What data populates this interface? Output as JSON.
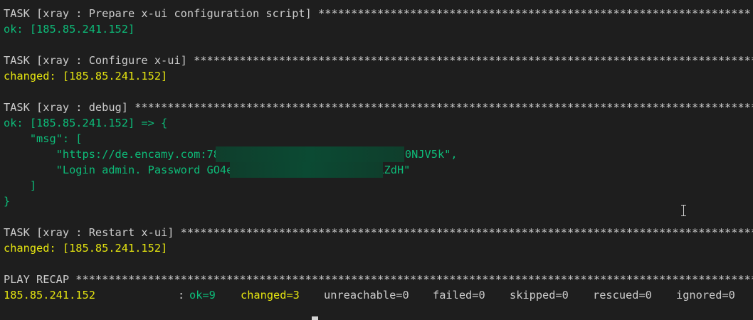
{
  "tasks": [
    {
      "header": "TASK [xray : Prepare x-ui configuration script] ******************************************************************",
      "status": "ok: [185.85.241.152]"
    },
    {
      "header": "TASK [xray : Configure x-ui] ****************************************************************************************",
      "status": "changed: [185.85.241.152]"
    },
    {
      "header": "TASK [xray : debug] *************************************************************************************************",
      "status": "ok: [185.85.241.152] => {"
    },
    {
      "header": "TASK [xray : Restart x-ui] ******************************************************************************************",
      "status": "changed: [185.85.241.152]"
    }
  ],
  "debug_output": {
    "msg_open": "    \"msg\": [",
    "url_line_prefix": "        \"https://de.encamy.com:78",
    "url_line_suffix": "0NJV5k\",",
    "login_line_prefix": "        \"Login admin. Password GO4e",
    "login_line_suffix": "LZdH\"",
    "msg_close": "    ]",
    "brace_close": "}"
  },
  "recap": {
    "header": "PLAY RECAP **********************************************************************************************************",
    "host": "185.85.241.152",
    "colon": ":",
    "ok": "ok=9",
    "changed": "changed=3",
    "unreachable": "unreachable=0",
    "failed": "failed=0",
    "skipped": "skipped=0",
    "rescued": "rescued=0",
    "ignored": "ignored=0"
  },
  "colors": {
    "background": "#1e1e1e",
    "text": "#cccccc",
    "ok": "#0dbc79",
    "changed": "#e5e510"
  },
  "icons": {
    "mouse_cursor": "i-beam-cursor-icon",
    "text_caret": "terminal-caret"
  }
}
